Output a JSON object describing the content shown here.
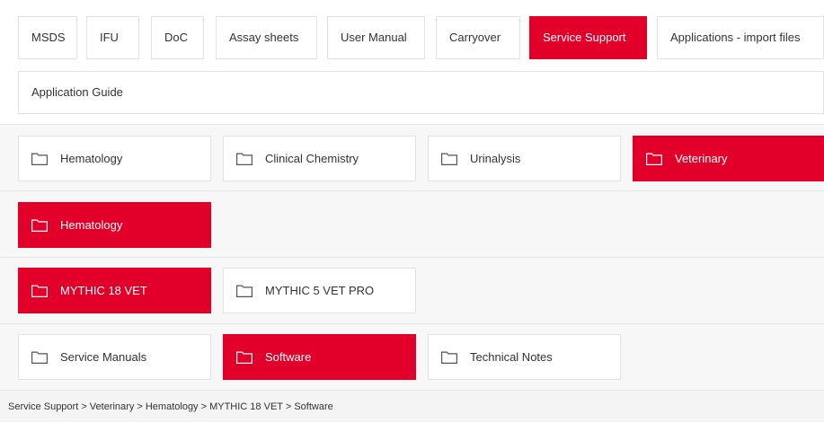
{
  "tabs": [
    {
      "label": "MSDS",
      "active": false
    },
    {
      "label": "IFU",
      "active": false
    },
    {
      "label": "DoC",
      "active": false
    },
    {
      "label": "Assay sheets",
      "active": false
    },
    {
      "label": "User Manual",
      "active": false
    },
    {
      "label": "Carryover",
      "active": false
    },
    {
      "label": "Service Support",
      "active": true
    },
    {
      "label": "Applications - import files",
      "active": false
    },
    {
      "label": "Application Guide",
      "active": false
    }
  ],
  "level1": [
    {
      "label": "Hematology",
      "active": false
    },
    {
      "label": "Clinical Chemistry",
      "active": false
    },
    {
      "label": "Urinalysis",
      "active": false
    },
    {
      "label": "Veterinary",
      "active": true
    }
  ],
  "level2": [
    {
      "label": "Hematology",
      "active": true
    }
  ],
  "level3": [
    {
      "label": "MYTHIC 18 VET",
      "active": true
    },
    {
      "label": "MYTHIC 5 VET PRO",
      "active": false
    }
  ],
  "level4": [
    {
      "label": "Service Manuals",
      "active": false
    },
    {
      "label": "Software",
      "active": true
    },
    {
      "label": "Technical Notes",
      "active": false
    }
  ],
  "breadcrumb": "Service Support > Veterinary > Hematology > MYTHIC 18 VET > Software",
  "colors": {
    "accent": "#e2002a"
  },
  "icons": {
    "folder": "folder-icon"
  }
}
